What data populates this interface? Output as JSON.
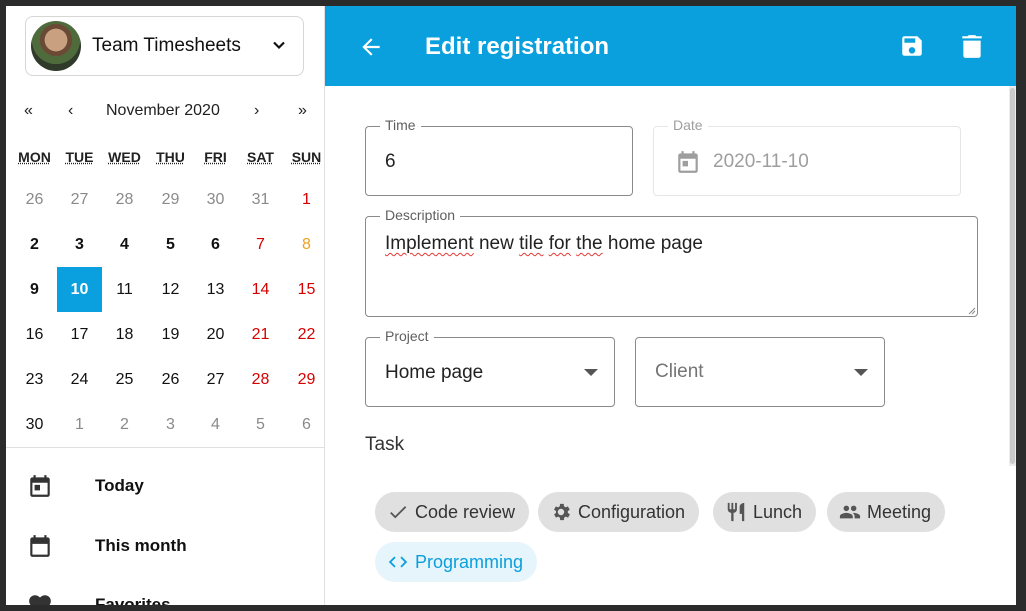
{
  "sidebar": {
    "team_name": "Team Timesheets",
    "calendar": {
      "prev_year": "«",
      "prev_month": "‹",
      "month_label": "November 2020",
      "next_month": "›",
      "next_year": "»",
      "weekdays": [
        "MON",
        "TUE",
        "WED",
        "THU",
        "FRI",
        "SAT",
        "SUN"
      ],
      "weeks": [
        [
          "26",
          "27",
          "28",
          "29",
          "30",
          "31",
          "1"
        ],
        [
          "2",
          "3",
          "4",
          "5",
          "6",
          "7",
          "8"
        ],
        [
          "9",
          "10",
          "11",
          "12",
          "13",
          "14",
          "15"
        ],
        [
          "16",
          "17",
          "18",
          "19",
          "20",
          "21",
          "22"
        ],
        [
          "23",
          "24",
          "25",
          "26",
          "27",
          "28",
          "29"
        ],
        [
          "30",
          "1",
          "2",
          "3",
          "4",
          "5",
          "6"
        ]
      ],
      "selected_day": "10"
    },
    "nav": [
      {
        "label": "Today",
        "icon": "calendar-today-icon"
      },
      {
        "label": "This month",
        "icon": "calendar-month-icon"
      },
      {
        "label": "Favorites",
        "icon": "heart-icon"
      }
    ]
  },
  "header": {
    "title": "Edit registration",
    "back_icon": "arrow-left-icon",
    "save_icon": "save-icon",
    "delete_icon": "trash-icon",
    "color": "#0a9fdd"
  },
  "form": {
    "time": {
      "label": "Time",
      "value": "6"
    },
    "date": {
      "label": "Date",
      "value": "2020-11-10"
    },
    "description": {
      "label": "Description",
      "words": [
        "Implement",
        "new",
        "tile",
        "for",
        "the",
        "home",
        "page"
      ]
    },
    "project": {
      "label": "Project",
      "value": "Home page"
    },
    "client": {
      "placeholder": "Client"
    },
    "task_label": "Task",
    "tasks": [
      {
        "label": "Code review",
        "icon": "check-icon",
        "selected": false
      },
      {
        "label": "Configuration",
        "icon": "gear-icon",
        "selected": false
      },
      {
        "label": "Lunch",
        "icon": "fork-knife-icon",
        "selected": false
      },
      {
        "label": "Meeting",
        "icon": "people-icon",
        "selected": false
      },
      {
        "label": "Programming",
        "icon": "code-icon",
        "selected": true
      }
    ]
  }
}
